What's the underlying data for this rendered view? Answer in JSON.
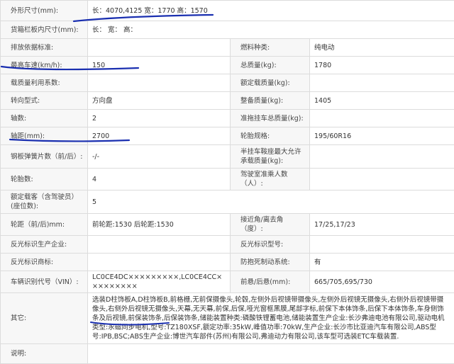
{
  "rows": [
    {
      "k1": "外形尺寸(mm):",
      "v1": "长：4070,4125 宽：1770 高：1570"
    },
    {
      "k1": "货箱栏板内尺寸(mm):",
      "v1": "长：  宽：  高："
    },
    {
      "k1": "排放依据标准:",
      "v1": "",
      "k2": "燃料种类:",
      "v2": "纯电动"
    },
    {
      "k1": "最高车速(km/h):",
      "v1": "150",
      "k2": "总质量(kg):",
      "v2": "1780"
    },
    {
      "k1": "载质量利用系数:",
      "v1": "",
      "k2": "额定载质量(kg):",
      "v2": ""
    },
    {
      "k1": "转向型式:",
      "v1": "方向盘",
      "k2": "整备质量(kg):",
      "v2": "1405"
    },
    {
      "k1": "轴数:",
      "v1": "2",
      "k2": "准拖挂车总质量(kg):",
      "v2": ""
    },
    {
      "k1": "轴距(mm):",
      "v1": "2700",
      "k2": "轮胎规格:",
      "v2": "195/60R16"
    },
    {
      "k1": "钢板弹簧片数（前/后）:",
      "v1": "-/-",
      "k2": "半挂车鞍座最大允许承载质量(kg):",
      "v2": ""
    },
    {
      "k1": "轮胎数:",
      "v1": "4",
      "k2": "驾驶室准乘人数（人）:",
      "v2": ""
    },
    {
      "k1": "额定载客（含驾驶员）(座位数):",
      "v1": "5"
    },
    {
      "k1": "轮距（前/后)mm:",
      "v1": "前轮距:1530 后轮距:1530",
      "k2": "接近角/离去角（度）:",
      "v2": "17/25,17/23"
    },
    {
      "k1": "反光标识生产企业:",
      "v1": "",
      "k2": "反光标识型号:",
      "v2": ""
    },
    {
      "k1": "反光标识商标:",
      "v1": "",
      "k2": "防抱死制动系统:",
      "v2": "有"
    },
    {
      "k1": "车辆识别代号（VIN）:",
      "v1": "LC0CE4DC×××××××××,LC0CE4CC×××××××××",
      "k2": "前悬/后悬(mm):",
      "v2": "665/705,695/730"
    }
  ],
  "other_label": "其它:",
  "other_text": "选装D柱饰板A,D柱饰板B,前格栅,无前保摄像头,轮毂,左侧外后视镜带摄像头,左侧外后视镜无摄像头,右侧外后视镜带摄像头,右侧外后视镜无摄像头,天幕,无天幕,前保,后保,哑光窗框黑膜,尾部字标,前保下本体饰条,后保下本体饰条,车身侧饰条及后视镜,前保装饰条,后保装饰条,储能装置种类:磷酸铁锂蓄电池,储能装置生产企业:长沙弗迪电池有限公司,驱动电机类型:永磁同步电机,型号:TZ180XSF,额定功率:35kW,峰值功率:70kW,生产企业:长沙市比亚迪汽车有限公司,ABS型号:IPB,BSC;ABS生产企业:博世汽车部件(苏州)有限公司,弗迪动力有限公司,该车型可选装ETC车载装置.",
  "desc_label": "说明:",
  "desc_text": "",
  "annotation_color": "#1a2fb0"
}
